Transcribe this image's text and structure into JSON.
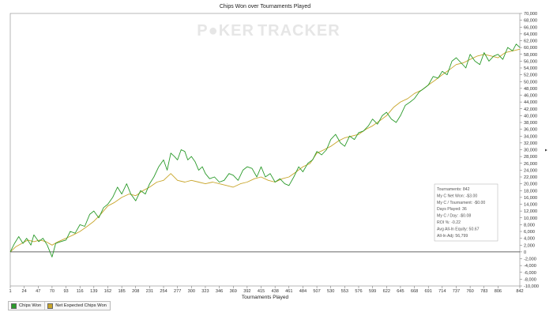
{
  "chart_data": {
    "type": "line",
    "title": "Chips Won over Tournaments Played",
    "xlabel": "Tournaments Played",
    "ylabel": "",
    "y_axis_side": "right",
    "xlim": [
      1,
      842
    ],
    "ylim": [
      -10000,
      70000
    ],
    "x_tick_labels": [
      "1",
      "24",
      "47",
      "70",
      "93",
      "116",
      "139",
      "162",
      "185",
      "208",
      "231",
      "254",
      "277",
      "300",
      "323",
      "346",
      "369",
      "392",
      "415",
      "438",
      "461",
      "484",
      "507",
      "530",
      "553",
      "576",
      "599",
      "622",
      "645",
      "668",
      "691",
      "714",
      "737",
      "760",
      "783",
      "806",
      "842"
    ],
    "y_ticks": [
      -10000,
      -8000,
      -6000,
      -4000,
      -2000,
      0,
      2000,
      4000,
      6000,
      8000,
      10000,
      12000,
      14000,
      16000,
      18000,
      20000,
      22000,
      24000,
      26000,
      28000,
      30000,
      32000,
      34000,
      36000,
      38000,
      40000,
      42000,
      44000,
      46000,
      48000,
      50000,
      52000,
      54000,
      56000,
      58000,
      60000,
      62000,
      64000,
      66000,
      68000,
      70000
    ],
    "y_tick_labels": [
      "-10,000",
      "-8,000",
      "-6,000",
      "-4,000",
      "-2,000",
      "0",
      "2,000",
      "4,000",
      "6,000",
      "8,000",
      "10,000",
      "12,000",
      "14,000",
      "16,000",
      "18,000",
      "20,000",
      "22,000",
      "24,000",
      "26,000",
      "28,000",
      "30,000",
      "32,000",
      "34,000",
      "36,000",
      "38,000",
      "40,000",
      "42,000",
      "44,000",
      "46,000",
      "48,000",
      "50,000",
      "52,000",
      "54,000",
      "56,000",
      "58,000",
      "60,000",
      "62,000",
      "64,000",
      "66,000",
      "68,000",
      "70,000"
    ],
    "grid": false,
    "zero_line": true,
    "legend_position": "bottom-left",
    "series": [
      {
        "name": "Chips Won",
        "color": "#2a9a2a",
        "x": [
          1,
          8,
          15,
          22,
          28,
          35,
          40,
          48,
          55,
          62,
          70,
          76,
          84,
          93,
          100,
          108,
          116,
          124,
          132,
          139,
          147,
          155,
          162,
          170,
          178,
          185,
          193,
          200,
          208,
          216,
          224,
          231,
          238,
          246,
          254,
          260,
          266,
          272,
          277,
          283,
          289,
          294,
          300,
          306,
          312,
          318,
          323,
          330,
          338,
          346,
          354,
          362,
          369,
          377,
          385,
          392,
          400,
          408,
          415,
          422,
          430,
          438,
          446,
          454,
          461,
          469,
          477,
          484,
          492,
          500,
          507,
          515,
          523,
          530,
          538,
          546,
          553,
          561,
          569,
          576,
          584,
          592,
          599,
          607,
          615,
          622,
          630,
          638,
          645,
          653,
          661,
          668,
          676,
          684,
          691,
          699,
          707,
          714,
          722,
          730,
          737,
          745,
          753,
          760,
          768,
          776,
          783,
          791,
          799,
          806,
          814,
          822,
          830,
          836,
          842
        ],
        "values": [
          0,
          2500,
          4500,
          2500,
          4000,
          2000,
          5000,
          3000,
          4000,
          2000,
          -1500,
          2500,
          3000,
          3500,
          6000,
          5500,
          8000,
          7500,
          11000,
          12000,
          10000,
          13000,
          14000,
          16000,
          19000,
          17000,
          20000,
          17000,
          15000,
          18000,
          17000,
          20000,
          22000,
          25000,
          27000,
          24000,
          29000,
          28000,
          27000,
          30000,
          29500,
          27000,
          28000,
          26500,
          24000,
          25000,
          23000,
          21500,
          22000,
          20500,
          21000,
          23000,
          22500,
          21000,
          24000,
          25000,
          24500,
          22000,
          25000,
          22000,
          23000,
          20500,
          21500,
          20000,
          19500,
          22000,
          25000,
          23500,
          26000,
          27000,
          29500,
          28500,
          30000,
          33000,
          34500,
          32000,
          31000,
          34000,
          33000,
          35000,
          35500,
          37000,
          39000,
          37500,
          40000,
          41000,
          39000,
          38000,
          40000,
          43000,
          44000,
          45000,
          47000,
          48000,
          49000,
          51500,
          51000,
          53000,
          52000,
          56000,
          57000,
          55500,
          54000,
          58000,
          56000,
          55000,
          58500,
          56000,
          57500,
          58000,
          56500,
          60000,
          59000,
          61000,
          60000
        ]
      },
      {
        "name": "Net Expected Chips Won",
        "color": "#c8a52a",
        "x": [
          1,
          10,
          20,
          30,
          40,
          50,
          60,
          70,
          80,
          93,
          105,
          116,
          128,
          139,
          150,
          162,
          173,
          185,
          197,
          208,
          220,
          231,
          243,
          254,
          266,
          277,
          289,
          300,
          312,
          323,
          335,
          346,
          358,
          369,
          381,
          392,
          404,
          415,
          427,
          438,
          450,
          461,
          473,
          484,
          496,
          507,
          519,
          530,
          542,
          553,
          565,
          576,
          588,
          599,
          611,
          622,
          634,
          645,
          657,
          668,
          680,
          691,
          703,
          714,
          726,
          737,
          749,
          760,
          772,
          783,
          795,
          806,
          818,
          830,
          842
        ],
        "values": [
          0,
          1500,
          2500,
          3500,
          3000,
          3500,
          3000,
          2000,
          3000,
          4000,
          5000,
          6000,
          7500,
          9000,
          11000,
          13500,
          14500,
          16000,
          17000,
          16500,
          18000,
          19000,
          20500,
          21000,
          23000,
          21000,
          20500,
          21000,
          20500,
          20000,
          20500,
          20000,
          19500,
          19000,
          20000,
          20500,
          21500,
          22000,
          21000,
          20500,
          21500,
          22000,
          23500,
          25000,
          26000,
          29000,
          30000,
          31000,
          32500,
          33500,
          34000,
          34500,
          36000,
          37000,
          38500,
          40000,
          42500,
          44000,
          45000,
          46500,
          47500,
          49000,
          50500,
          52000,
          53500,
          55000,
          55500,
          56500,
          57500,
          58000,
          57500,
          57000,
          58500,
          59000,
          59500
        ]
      }
    ]
  },
  "watermark": {
    "prefix": "P",
    "middle": "KER",
    "suffix": "TRACKER"
  },
  "stats_box": {
    "lines": [
      "Tournaments: 842",
      "My C Net Won: -$3.00",
      "My C / Tournament: -$0.00",
      "Days Played: 36",
      "My C / Day: -$0.08",
      "ROI %: -0.22",
      "Avg All-In Equity: 50.67",
      "All-In Adj: 56,799"
    ]
  },
  "legend": {
    "items": [
      {
        "label": "Chips Won",
        "color": "#2a9a2a"
      },
      {
        "label": "Net Expected Chips Won",
        "color": "#c8a52a"
      }
    ]
  }
}
